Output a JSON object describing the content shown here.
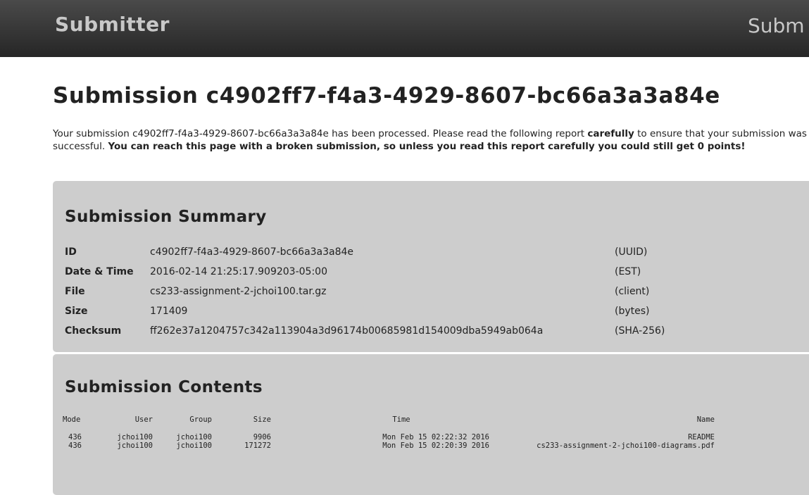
{
  "nav": {
    "brand": "Submitter",
    "link": "Subm"
  },
  "page": {
    "title": "Submission c4902ff7-f4a3-4929-8607-bc66a3a3a84e",
    "intro": {
      "part1": "Your submission c4902ff7-f4a3-4929-8607-bc66a3a3a84e has been processed. Please read the following report ",
      "bold1": "carefully",
      "part2": " to ensure that your submission was successful. ",
      "bold2": "You can reach this page with a broken submission, so unless you read this report carefully you could still get 0 points!"
    }
  },
  "summary": {
    "title": "Submission Summary",
    "rows": [
      {
        "key": "ID",
        "value": "c4902ff7-f4a3-4929-8607-bc66a3a3a84e",
        "note": "(UUID)"
      },
      {
        "key": "Date & Time",
        "value": "2016-02-14 21:25:17.909203-05:00",
        "note": "(EST)"
      },
      {
        "key": "File",
        "value": "cs233-assignment-2-jchoi100.tar.gz",
        "note": "(client)"
      },
      {
        "key": "Size",
        "value": "171409",
        "note": "(bytes)"
      },
      {
        "key": "Checksum",
        "value": "ff262e37a1204757c342a113904a3d96174b00685981d154009dba5949ab064a",
        "note": "(SHA-256)"
      }
    ]
  },
  "contents": {
    "title": "Submission Contents",
    "headers": {
      "mode": "Mode",
      "user": "User",
      "group": "Group",
      "size": "Size",
      "time": "Time",
      "name": "Name"
    },
    "rows": [
      {
        "mode": "436",
        "user": "jchoi100",
        "group": "jchoi100",
        "size": "9906",
        "time": "Mon Feb 15 02:22:32 2016",
        "name": "README"
      },
      {
        "mode": "436",
        "user": "jchoi100",
        "group": "jchoi100",
        "size": "171272",
        "time": "Mon Feb 15 02:20:39 2016",
        "name": "cs233-assignment-2-jchoi100-diagrams.pdf"
      }
    ]
  }
}
